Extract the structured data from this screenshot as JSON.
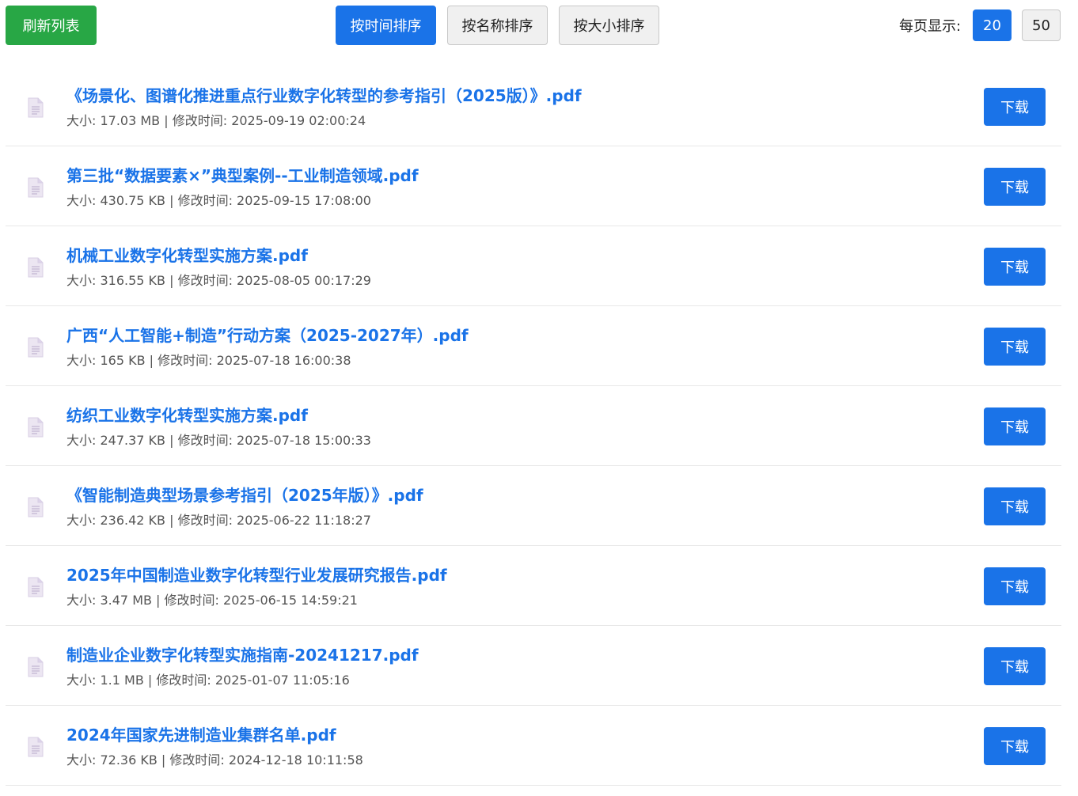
{
  "toolbar": {
    "refresh_label": "刷新列表",
    "sort_buttons": [
      {
        "label": "按时间排序",
        "active": true
      },
      {
        "label": "按名称排序",
        "active": false
      },
      {
        "label": "按大小排序",
        "active": false
      }
    ],
    "per_page_label": "每页显示:",
    "per_page_options": [
      {
        "label": "20",
        "active": true
      },
      {
        "label": "50",
        "active": false
      }
    ]
  },
  "files": [
    {
      "name": "《场景化、图谱化推进重点行业数字化转型的参考指引（2025版）》.pdf",
      "meta": "大小: 17.03 MB | 修改时间: 2025-09-19 02:00:24",
      "download_label": "下载"
    },
    {
      "name": "第三批“数据要素×”典型案例--工业制造领域.pdf",
      "meta": "大小: 430.75 KB | 修改时间: 2025-09-15 17:08:00",
      "download_label": "下载"
    },
    {
      "name": "机械工业数字化转型实施方案.pdf",
      "meta": "大小: 316.55 KB | 修改时间: 2025-08-05 00:17:29",
      "download_label": "下载"
    },
    {
      "name": "广西“人工智能+制造”行动方案（2025-2027年）.pdf",
      "meta": "大小: 165 KB | 修改时间: 2025-07-18 16:00:38",
      "download_label": "下载"
    },
    {
      "name": "纺织工业数字化转型实施方案.pdf",
      "meta": "大小: 247.37 KB | 修改时间: 2025-07-18 15:00:33",
      "download_label": "下载"
    },
    {
      "name": "《智能制造典型场景参考指引（2025年版）》.pdf",
      "meta": "大小: 236.42 KB | 修改时间: 2025-06-22 11:18:27",
      "download_label": "下载"
    },
    {
      "name": "2025年中国制造业数字化转型行业发展研究报告.pdf",
      "meta": "大小: 3.47 MB | 修改时间: 2025-06-15 14:59:21",
      "download_label": "下载"
    },
    {
      "name": "制造业企业数字化转型实施指南-20241217.pdf",
      "meta": "大小: 1.1 MB | 修改时间: 2025-01-07 11:05:16",
      "download_label": "下载"
    },
    {
      "name": "2024年国家先进制造业集群名单.pdf",
      "meta": "大小: 72.36 KB | 修改时间: 2024-12-18 10:11:58",
      "download_label": "下载"
    }
  ],
  "colors": {
    "accent": "#1a73e8",
    "refresh": "#28a745"
  },
  "icons": {
    "file": "document-icon"
  }
}
